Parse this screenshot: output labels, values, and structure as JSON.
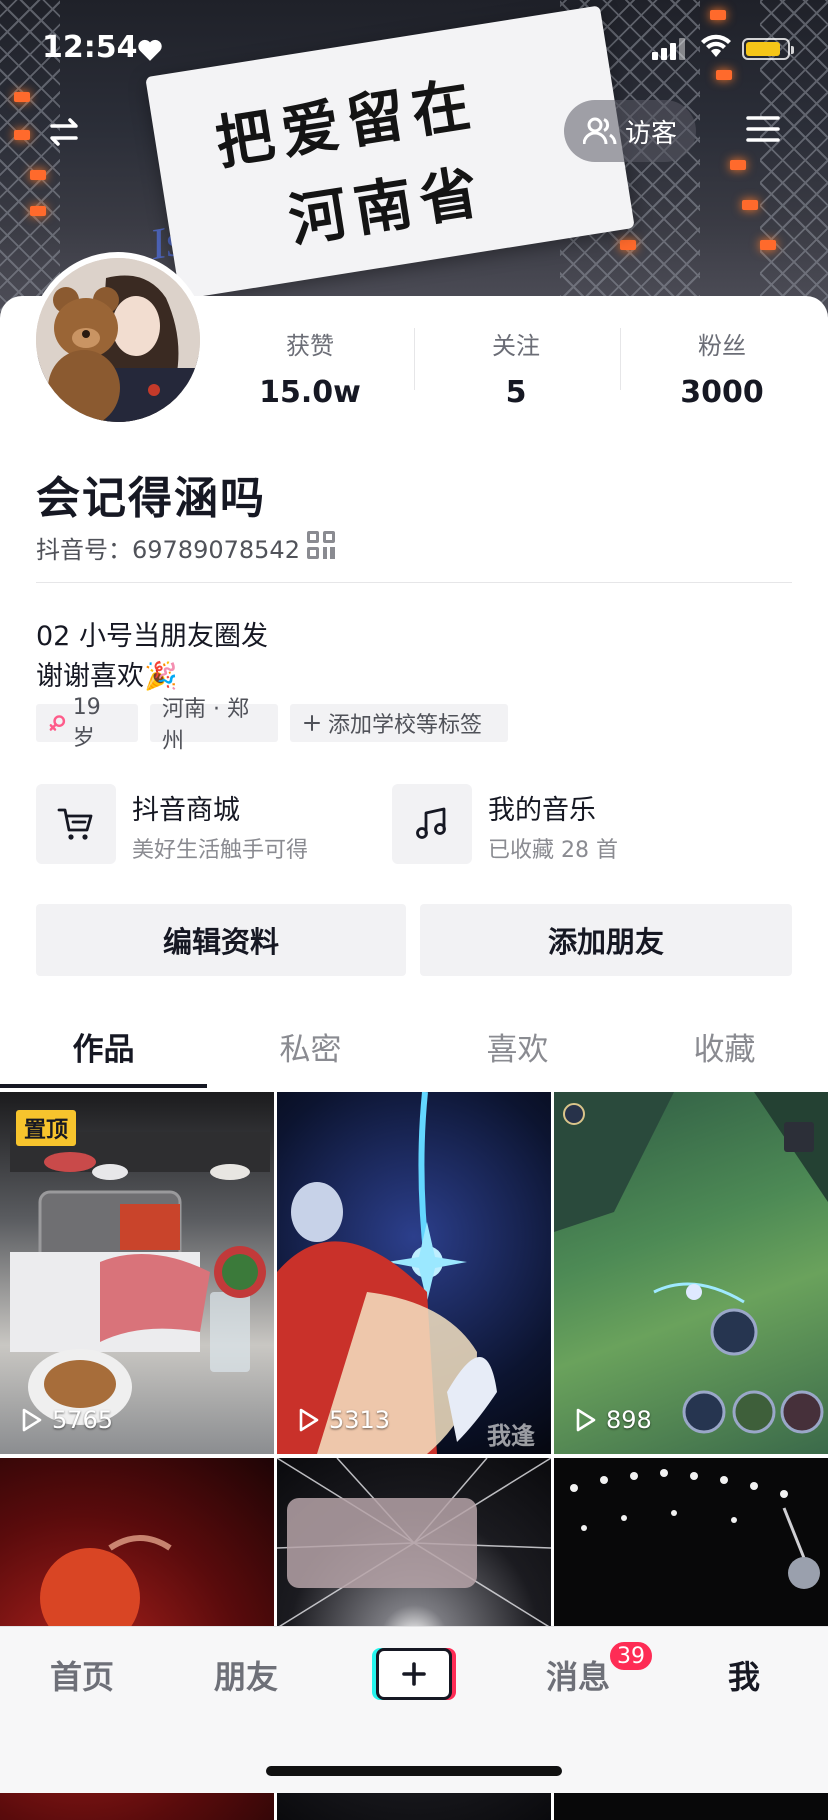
{
  "status_bar": {
    "time": "12:54",
    "battery_level": 0.85,
    "battery_color": "#f5c518"
  },
  "banner": {
    "flag_line1": "把爱留在",
    "flag_line2": "河南省",
    "background_text": "Island"
  },
  "top_bar": {
    "visitor_label": "访客"
  },
  "profile": {
    "stats": [
      {
        "label": "获赞",
        "value": "15.0w"
      },
      {
        "label": "关注",
        "value": "5"
      },
      {
        "label": "粉丝",
        "value": "3000"
      }
    ],
    "nickname": "会记得涵吗",
    "douyin_id": "抖音号：69789078542",
    "bio_line1": "02 小号当朋友圈发",
    "bio_line2": "谢谢喜欢🎉",
    "tags": {
      "age": "19 岁",
      "location": "河南 · 郑州",
      "add_school": "添加学校等标签"
    },
    "entries": [
      {
        "title": "抖音商城",
        "subtitle": "美好生活触手可得",
        "icon": "cart-icon"
      },
      {
        "title": "我的音乐",
        "subtitle": "已收藏 28 首",
        "icon": "music-note-icon"
      }
    ],
    "buttons": {
      "edit": "编辑资料",
      "add_friend": "添加朋友"
    }
  },
  "tabs": [
    "作品",
    "私密",
    "喜欢",
    "收藏"
  ],
  "videos": [
    {
      "plays": "5765",
      "pinned_label": "置顶"
    },
    {
      "plays": "5313",
      "watermark": "我逢"
    },
    {
      "plays": "898"
    },
    {},
    {},
    {}
  ],
  "bottom_nav": {
    "home": "首页",
    "friends": "朋友",
    "messages": "消息",
    "messages_badge": "39",
    "me": "我"
  },
  "colors": {
    "accent_red": "#fe2c55",
    "accent_cyan": "#25f4ee",
    "pin_yellow": "#f7c42d"
  }
}
